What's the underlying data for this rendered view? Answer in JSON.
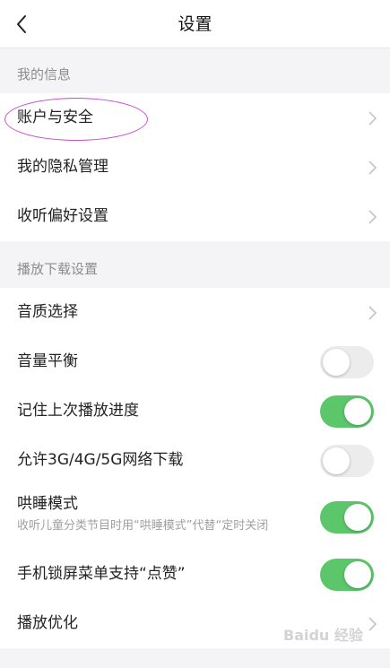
{
  "header": {
    "title": "设置",
    "back_icon": "chevron-left-icon"
  },
  "sections": [
    {
      "title": "我的信息",
      "rows": [
        {
          "label": "账户与安全",
          "control": "chevron"
        },
        {
          "label": "我的隐私管理",
          "control": "chevron"
        },
        {
          "label": "收听偏好设置",
          "control": "chevron"
        }
      ]
    },
    {
      "title": "播放下载设置",
      "rows": [
        {
          "label": "音质选择",
          "control": "chevron"
        },
        {
          "label": "音量平衡",
          "control": "toggle",
          "on": false
        },
        {
          "label": "记住上次播放进度",
          "control": "toggle",
          "on": true
        },
        {
          "label": "允许3G/4G/5G网络下载",
          "control": "toggle",
          "on": false
        },
        {
          "label": "哄睡模式",
          "sublabel": "收听儿童分类节目时用“哄睡模式”代替“定时关闭",
          "control": "toggle",
          "on": true
        },
        {
          "label": "手机锁屏菜单支持“点赞”",
          "control": "toggle",
          "on": true
        },
        {
          "label": "播放优化",
          "control": "chevron"
        }
      ]
    }
  ],
  "colors": {
    "toggle_on": "#5cc66b",
    "toggle_off": "#ececec",
    "annotation_ellipse": "#c64bd1"
  },
  "watermark": "Baidu 经验"
}
